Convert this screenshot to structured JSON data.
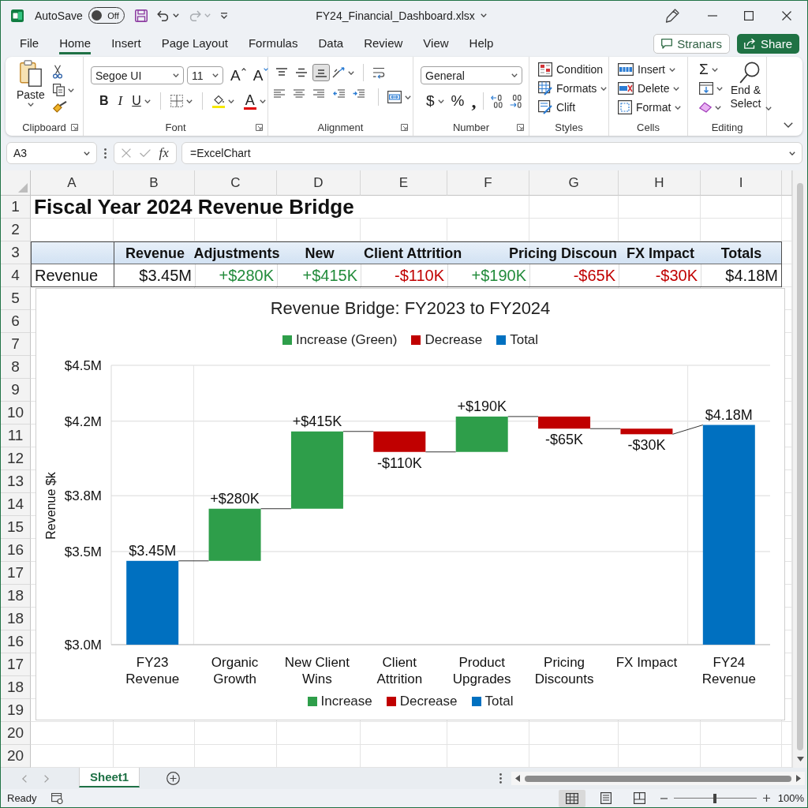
{
  "title_bar": {
    "quick_access": [
      {
        "kind": "save",
        "disabled": false
      },
      {
        "kind": "undo",
        "disabled": false
      },
      {
        "kind": "redo",
        "disabled": true
      },
      {
        "kind": "customize",
        "disabled": false
      }
    ],
    "autosave_label": "AutoSave",
    "autosave": {
      "label": "Off",
      "on": false
    },
    "file_name": "FY24_Financial_Dashboard.xlsx"
  },
  "menu_tabs": [
    {
      "label": "File",
      "selected": false
    },
    {
      "label": "Home",
      "selected": true
    },
    {
      "label": "Insert",
      "selected": false
    },
    {
      "label": "Page Layout",
      "selected": false
    },
    {
      "label": "Formulas",
      "selected": false
    },
    {
      "label": "Data",
      "selected": false
    },
    {
      "label": "Review",
      "selected": false
    },
    {
      "label": "View",
      "selected": false
    },
    {
      "label": "Help",
      "selected": false
    }
  ],
  "header_buttons": {
    "comments": "Stranars",
    "share": "Share"
  },
  "ribbon": {
    "clipboard": {
      "label": "Clipboard",
      "launcher": true,
      "paste": "Paste"
    },
    "font": {
      "label": "Font",
      "launcher": true,
      "font_name": "Segoe UI",
      "font_size": "11",
      "grow": "A",
      "shrink": "A",
      "styles": [
        {
          "kind": "bold",
          "label": "B"
        },
        {
          "kind": "italic",
          "label": "I"
        },
        {
          "kind": "underline",
          "label": "U"
        }
      ],
      "font_color": "A"
    },
    "alignment": {
      "label": "Alignment",
      "launcher": true,
      "vertical": [
        {
          "kind": "top",
          "selected": false
        },
        {
          "kind": "middle",
          "selected": false
        },
        {
          "kind": "bottom",
          "selected": true
        }
      ],
      "horizontal": [
        {
          "kind": "left"
        },
        {
          "kind": "center"
        },
        {
          "kind": "right"
        },
        {
          "kind": "outdent"
        },
        {
          "kind": "indent"
        }
      ]
    },
    "number": {
      "label": "Number",
      "launcher": true,
      "format": "General",
      "symbols": [
        {
          "kind": "currency",
          "label": "$"
        },
        {
          "kind": "percent",
          "label": "%"
        },
        {
          "kind": "comma",
          "label": ","
        }
      ]
    },
    "styles": {
      "label": "Styles",
      "items": [
        {
          "kind": "conditional",
          "label": "Condition",
          "dropdown": false
        },
        {
          "kind": "table",
          "label": "Formats",
          "dropdown": true
        },
        {
          "kind": "cell",
          "label": "Clift",
          "dropdown": false
        }
      ]
    },
    "cells": {
      "label": "Cells",
      "items": [
        {
          "kind": "insert",
          "label": "Insert"
        },
        {
          "kind": "delete",
          "label": "Delete"
        },
        {
          "kind": "format",
          "label": "Format"
        }
      ]
    },
    "editing": {
      "label": "Editing",
      "autosum": "Σ",
      "find": "End & Select"
    }
  },
  "formula_bar": {
    "name_box": "A3",
    "function_label": "fx",
    "formula": "=ExcelChart"
  },
  "sheet": {
    "columns": [
      "A",
      "B",
      "C",
      "D",
      "E",
      "F",
      "G",
      "H",
      "I"
    ],
    "row_numbers": [
      "1",
      "2",
      "3",
      "4",
      "5",
      "6",
      "7",
      "8",
      "9",
      "10",
      "11",
      "12",
      "13",
      "14",
      "15",
      "16",
      "17",
      "18",
      "18",
      "16",
      "17",
      "18",
      "19",
      "20",
      "20"
    ],
    "title": "Fiscal Year 2024 Revenue Bridge",
    "header_row": [
      {
        "kind": "blank"
      },
      {
        "kind": "text",
        "text": "Revenue"
      },
      {
        "kind": "text",
        "text": "Adjustments"
      },
      {
        "kind": "text",
        "text": "New"
      },
      {
        "kind": "text",
        "text": "Client Attrition"
      },
      {
        "kind": "blank"
      },
      {
        "kind": "text",
        "text": "Pricing Discoun"
      },
      {
        "kind": "text",
        "text": "FX Impact"
      },
      {
        "kind": "text",
        "text": "Totals"
      }
    ],
    "data_row": [
      {
        "text": "Revenue",
        "color": "#111111"
      },
      {
        "text": "$3.45M",
        "color": "#111111"
      },
      {
        "text": "+$280K",
        "color": "#228b3b"
      },
      {
        "text": "+$415K",
        "color": "#228b3b"
      },
      {
        "text": "-$110K",
        "color": "#c00000"
      },
      {
        "text": "+$190K",
        "color": "#228b3b"
      },
      {
        "text": "-$65K",
        "color": "#c00000"
      },
      {
        "text": "-$30K",
        "color": "#c00000"
      },
      {
        "text": "$4.18M",
        "color": "#111111"
      }
    ]
  },
  "chart": {
    "title": "Revenue Bridge: FY2023 to FY2024",
    "top_legend": [
      "Increase (Green)",
      "Decrease",
      "Total"
    ],
    "chart_data": {
      "type": "candlestick",
      "grid": true,
      "legend": "bottom",
      "ylabel": "Revenue $k",
      "categories": [
        "FY23 Revenue",
        "Organic Growth",
        "New Client Wins",
        "Client Attrition",
        "Product Upgrades",
        "Pricing Discounts",
        "FX Impact",
        "FY24 Revenue"
      ],
      "series": [
        {
          "name": "Increase",
          "color": "#2e9e4a",
          "ohlc": [
            null,
            [
              3.45,
              3.73,
              3.45,
              3.73
            ],
            [
              3.73,
              4.145,
              3.73,
              4.145
            ],
            null,
            [
              4.035,
              4.225,
              4.035,
              4.225
            ],
            null,
            null,
            null
          ]
        },
        {
          "name": "Decrease",
          "color": "#c00000",
          "ohlc": [
            null,
            null,
            null,
            [
              4.145,
              4.145,
              4.035,
              4.035
            ],
            null,
            [
              4.225,
              4.225,
              4.16,
              4.16
            ],
            [
              4.16,
              4.16,
              4.13,
              4.13
            ],
            null
          ]
        },
        {
          "name": "Total",
          "color": "#0070c0",
          "ohlc": [
            [
              3.0,
              3.45,
              3.0,
              3.45
            ],
            null,
            null,
            null,
            null,
            null,
            null,
            [
              3.0,
              4.18,
              3.0,
              4.18
            ]
          ]
        }
      ],
      "ylim": [
        3.0,
        4.5
      ],
      "yticks": [
        {
          "value": 3.0,
          "label": "$3.0M"
        },
        {
          "value": 3.5,
          "label": "$3.5M"
        },
        {
          "value": 3.8,
          "label": "$3.8M"
        },
        {
          "value": 4.2,
          "label": "$4.2M"
        },
        {
          "value": 4.5,
          "label": "$4.5M"
        }
      ],
      "value_labels": [
        "$3.45M",
        "+$280K",
        "+$415K",
        "-$110K",
        "+$190K",
        "-$65K",
        "-$30K",
        "$4.18M"
      ]
    }
  },
  "sheet_tabs": [
    {
      "label": "Sheet1",
      "selected": true
    }
  ],
  "status_bar": {
    "status": "Ready",
    "views": [
      {
        "kind": "normal",
        "selected": true
      },
      {
        "kind": "page-layout",
        "selected": false
      },
      {
        "kind": "page-break",
        "selected": false
      }
    ],
    "zoom": {
      "level": 0.5,
      "reading": "100%"
    }
  }
}
